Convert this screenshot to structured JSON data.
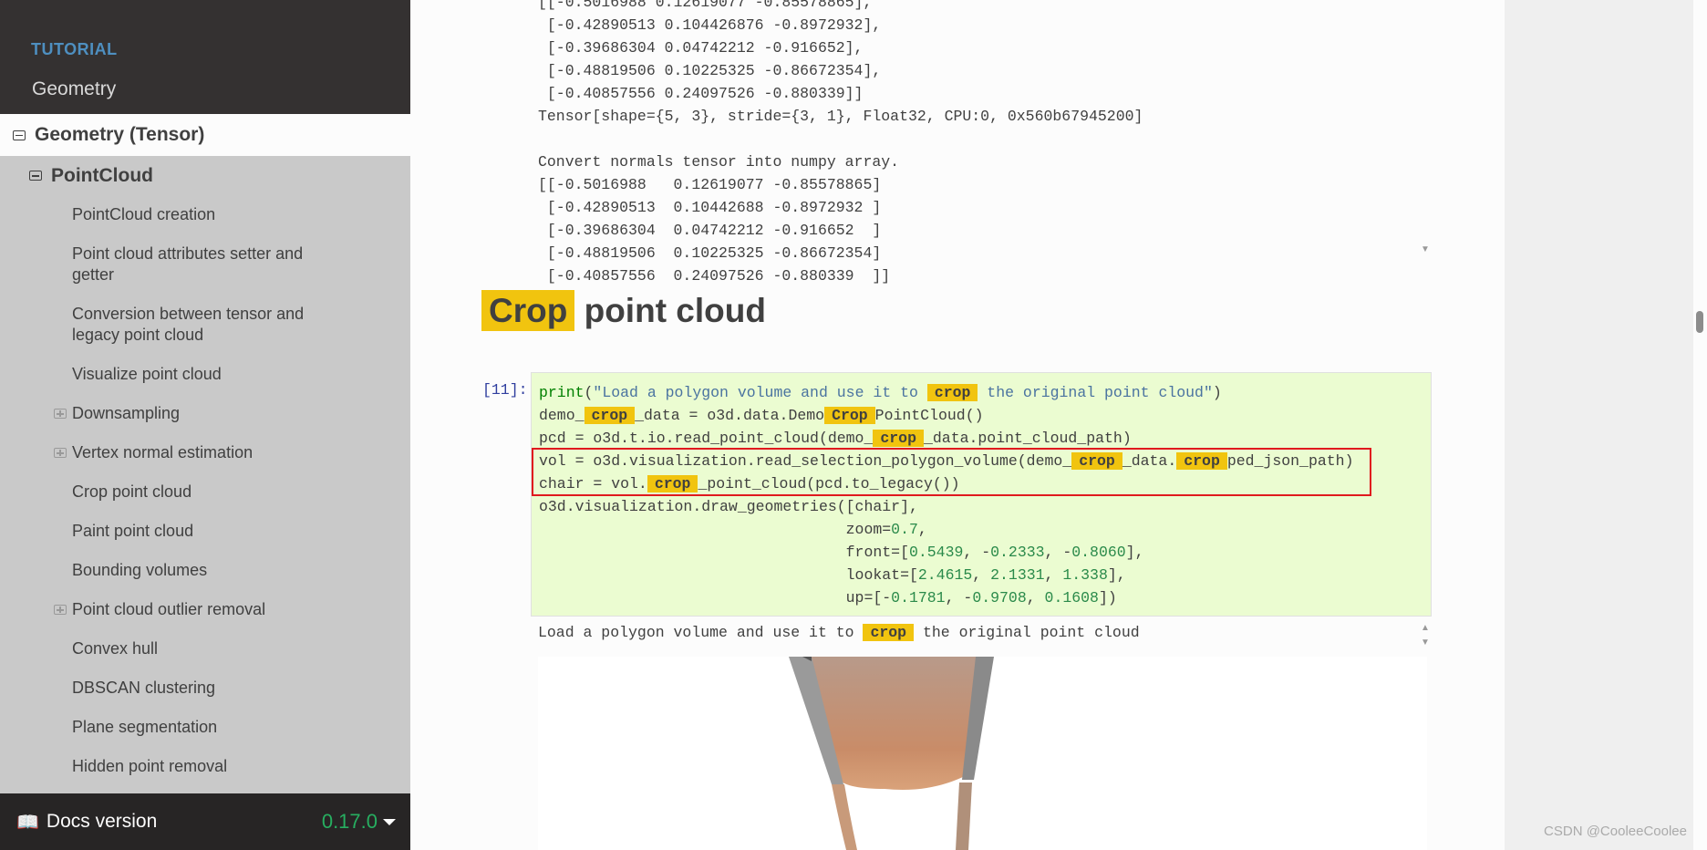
{
  "sidebar": {
    "caption": "TUTORIAL",
    "top_item": "Geometry",
    "current_l1": "Geometry (Tensor)",
    "current_l2": "PointCloud",
    "items": [
      {
        "label": "PointCloud creation",
        "expandable": false
      },
      {
        "label": "Point cloud attributes setter and getter",
        "expandable": false
      },
      {
        "label": "Conversion between tensor and legacy point cloud",
        "expandable": false
      },
      {
        "label": "Visualize point cloud",
        "expandable": false
      },
      {
        "label": "Downsampling",
        "expandable": true
      },
      {
        "label": "Vertex normal estimation",
        "expandable": true
      },
      {
        "label": "Crop point cloud",
        "expandable": false
      },
      {
        "label": "Paint point cloud",
        "expandable": false
      },
      {
        "label": "Bounding volumes",
        "expandable": false
      },
      {
        "label": "Point cloud outlier removal",
        "expandable": true
      },
      {
        "label": "Convex hull",
        "expandable": false
      },
      {
        "label": "DBSCAN clustering",
        "expandable": false
      },
      {
        "label": "Plane segmentation",
        "expandable": false
      },
      {
        "label": "Hidden point removal",
        "expandable": false
      }
    ],
    "footer": {
      "label": "Docs version",
      "version": "0.17.0",
      "icon": "book-icon"
    }
  },
  "previous_output": [
    "[[-0.5016988 0.12619077 -0.85578865],",
    " [-0.42890513 0.104426876 -0.8972932],",
    " [-0.39686304 0.04742212 -0.916652],",
    " [-0.48819506 0.10225325 -0.86672354],",
    " [-0.40857556 0.24097526 -0.880339]]",
    "Tensor[shape={5, 3}, stride={3, 1}, Float32, CPU:0, 0x560b67945200]",
    "",
    "Convert normals tensor into numpy array.",
    "[[-0.5016988   0.12619077 -0.85578865]",
    " [-0.42890513  0.10442688 -0.8972932 ]",
    " [-0.39686304  0.04742212 -0.916652  ]",
    " [-0.48819506  0.10225325 -0.86672354]",
    " [-0.40857556  0.24097526 -0.880339  ]]"
  ],
  "section": {
    "title_highlight": "Crop",
    "title_rest": " point cloud"
  },
  "cell": {
    "prompt": "[11]:",
    "lines": [
      [
        [
          "kf",
          "print"
        ],
        [
          "",
          "("
        ],
        [
          "st",
          "\"Load a polygon volume and use it to "
        ],
        [
          "hl",
          "crop"
        ],
        [
          "st",
          " the original point cloud\""
        ],
        [
          "",
          ")"
        ]
      ],
      [
        [
          "",
          "demo_"
        ],
        [
          "hl",
          "crop"
        ],
        [
          "",
          "_data = o3d.data.Demo"
        ],
        [
          "hl",
          "Crop"
        ],
        [
          "",
          "PointCloud()"
        ]
      ],
      [
        [
          "",
          "pcd = o3d.t.io.read_point_cloud(demo_"
        ],
        [
          "hl",
          "crop"
        ],
        [
          "",
          "_data.point_cloud_path)"
        ]
      ],
      [
        [
          "",
          "vol = o3d.visualization.read_selection_polygon_volume(demo_"
        ],
        [
          "hl",
          "crop"
        ],
        [
          "",
          "_data."
        ],
        [
          "hl",
          "crop"
        ],
        [
          "",
          "ped_json_path)"
        ]
      ],
      [
        [
          "",
          "chair = vol."
        ],
        [
          "hl",
          "crop"
        ],
        [
          "",
          "_point_cloud(pcd.to_legacy())"
        ]
      ],
      [
        [
          "",
          "o3d.visualization.draw_geometries([chair],"
        ]
      ],
      [
        [
          "",
          "                                  zoom="
        ],
        [
          "nm",
          "0.7"
        ],
        [
          "",
          ","
        ]
      ],
      [
        [
          "",
          "                                  front=["
        ],
        [
          "nm",
          "0.5439"
        ],
        [
          "",
          ", -"
        ],
        [
          "nm",
          "0.2333"
        ],
        [
          "",
          ", -"
        ],
        [
          "nm",
          "0.8060"
        ],
        [
          "",
          "],"
        ]
      ],
      [
        [
          "",
          "                                  lookat=["
        ],
        [
          "nm",
          "2.4615"
        ],
        [
          "",
          ", "
        ],
        [
          "nm",
          "2.1331"
        ],
        [
          "",
          ", "
        ],
        [
          "nm",
          "1.338"
        ],
        [
          "",
          "],"
        ]
      ],
      [
        [
          "",
          "                                  up=[-"
        ],
        [
          "nm",
          "0.1781"
        ],
        [
          "",
          ", -"
        ],
        [
          "nm",
          "0.9708"
        ],
        [
          "",
          ", "
        ],
        [
          "nm",
          "0.1608"
        ],
        [
          "",
          "])"
        ]
      ]
    ]
  },
  "cell_output": {
    "before": "Load a polygon volume and use it to ",
    "highlight": "crop",
    "after": " the original point cloud"
  },
  "watermark": "CSDN @CooleeCoolee",
  "colors": {
    "highlight": "#f1c40f",
    "sidebar_dark": "#343131",
    "sidebar_bg": "#c9c9c9",
    "cell_bg": "#ebfcd1",
    "annotation_box": "#e0191e",
    "version": "#27ae60"
  }
}
